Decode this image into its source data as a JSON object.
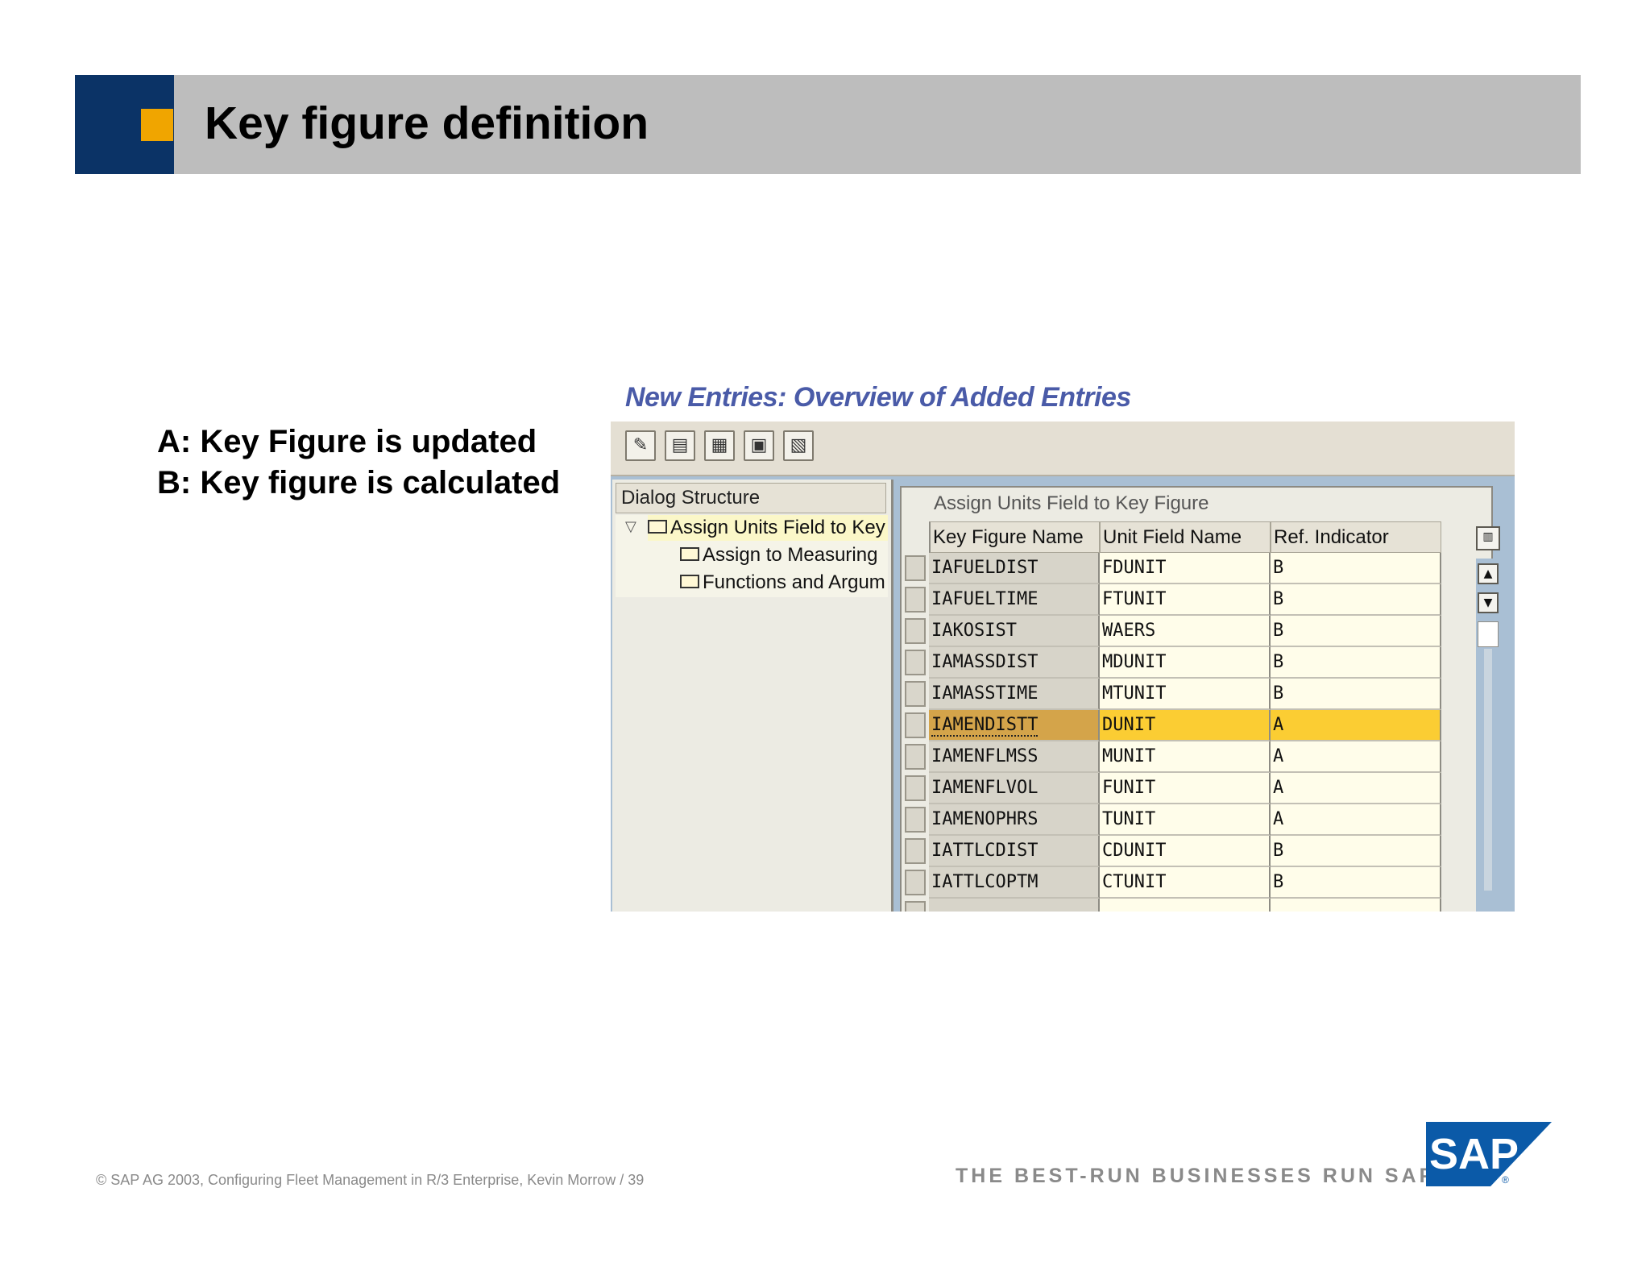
{
  "slide": {
    "title": "Key figure definition",
    "bullets": [
      "A: Key Figure is updated",
      "B: Key figure is calculated"
    ]
  },
  "screen": {
    "title": "New Entries: Overview of Added Entries",
    "toolbar": [
      {
        "icon": "pencil-glasses-icon",
        "glyph": "✎"
      },
      {
        "icon": "delete-row-icon",
        "glyph": "▤"
      },
      {
        "icon": "copy-entries-icon",
        "glyph": "▦"
      },
      {
        "icon": "export-icon",
        "glyph": "▣"
      },
      {
        "icon": "select-icon",
        "glyph": "▧"
      }
    ],
    "dialog_structure": {
      "header": "Dialog Structure",
      "items": [
        {
          "label": "Assign Units Field to Key",
          "selected": true
        },
        {
          "label": "Assign to Measuring",
          "selected": false
        },
        {
          "label": "Functions and Argum",
          "selected": false
        }
      ]
    },
    "table": {
      "title": "Assign Units Field to Key Figure",
      "columns": [
        "Key Figure Name",
        "Unit Field Name",
        "Ref. Indicator"
      ],
      "rows": [
        [
          "IAFUELDIST",
          "FDUNIT",
          "B"
        ],
        [
          "IAFUELTIME",
          "FTUNIT",
          "B"
        ],
        [
          "IAKOSIST",
          "WAERS",
          "B"
        ],
        [
          "IAMASSDIST",
          "MDUNIT",
          "B"
        ],
        [
          "IAMASSTIME",
          "MTUNIT",
          "B"
        ],
        [
          "IAMENDISTT",
          "DUNIT",
          "A"
        ],
        [
          "IAMENFLMSS",
          "MUNIT",
          "A"
        ],
        [
          "IAMENFLVOL",
          "FUNIT",
          "A"
        ],
        [
          "IAMENOPHRS",
          "TUNIT",
          "A"
        ],
        [
          "IATTLCDIST",
          "CDUNIT",
          "B"
        ],
        [
          "IATTLCOPTM",
          "CTUNIT",
          "B"
        ],
        [
          "",
          "",
          ""
        ]
      ],
      "highlighted_row": 5
    }
  },
  "footer": {
    "copyright": "© SAP AG 2003, Configuring Fleet Management in R/3 Enterprise, Kevin Morrow / 39",
    "tagline": "THE BEST-RUN BUSINESSES RUN SAP",
    "logo_text": "SAP",
    "logo_mark": "®"
  },
  "colors": {
    "header_blue": "#0b3366",
    "header_orange": "#f0a500",
    "header_gray": "#bdbdbd",
    "highlight_yellow": "#fbcd33",
    "sap_title_blue": "#4a5ba8"
  }
}
